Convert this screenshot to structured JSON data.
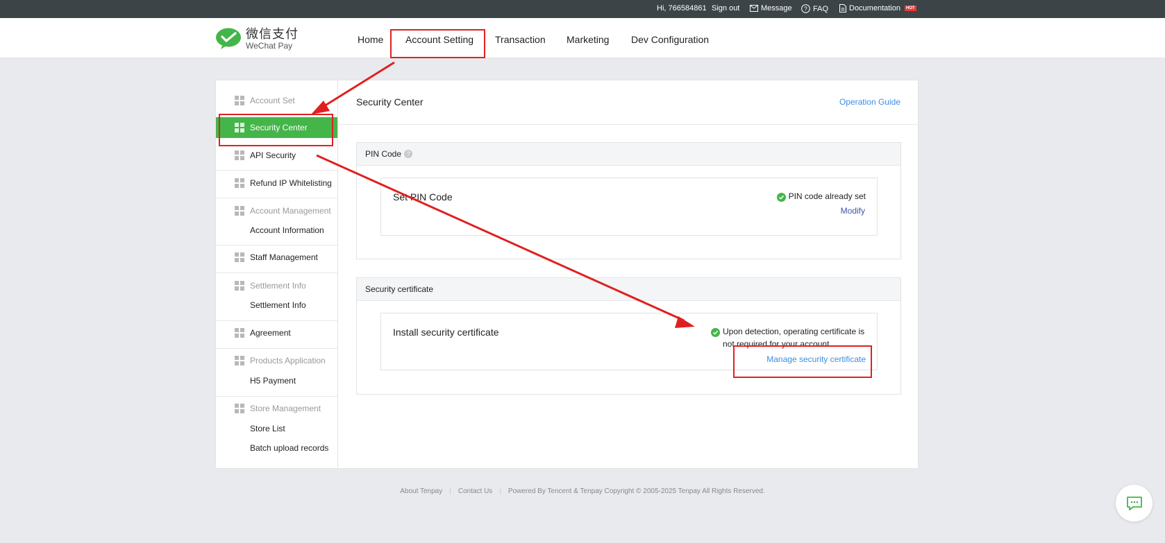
{
  "topbar": {
    "greeting": "Hi, 766584861",
    "sign_out": "Sign out",
    "message": "Message",
    "faq": "FAQ",
    "documentation": "Documentation",
    "hot_badge": "HOT"
  },
  "header": {
    "logo_cn": "微信支付",
    "logo_en": "WeChat Pay",
    "nav": [
      "Home",
      "Account Setting",
      "Transaction",
      "Marketing",
      "Dev Configuration"
    ]
  },
  "sidebar": {
    "account_set": "Account Set",
    "security_center": "Security Center",
    "api_security": "API Security",
    "refund_ip": "Refund IP Whitelisting",
    "account_management": "Account Management",
    "account_information": "Account Information",
    "staff_management": "Staff Management",
    "settlement_info_head": "Settlement Info",
    "settlement_info": "Settlement Info",
    "agreement": "Agreement",
    "products_application": "Products Application",
    "h5_payment": "H5 Payment",
    "store_management": "Store Management",
    "store_list": "Store List",
    "batch_upload": "Batch upload records"
  },
  "main": {
    "title": "Security Center",
    "operation_guide": "Operation Guide",
    "pin": {
      "header": "PIN Code",
      "help": "?",
      "label": "Set PIN Code",
      "status": "PIN code already set",
      "action": "Modify"
    },
    "cert": {
      "header": "Security certificate",
      "label": "Install security certificate",
      "status_line1": "Upon detection, operating certificate is",
      "status_line2": "not required for your account",
      "action": "Manage security certificate"
    }
  },
  "footer": {
    "about": "About Tenpay",
    "contact": "Contact Us",
    "copyright": "Powered By Tencent & Tenpay Copyright © 2005-2025 Tenpay All Rights Reserved."
  },
  "colors": {
    "accent_green": "#44b549",
    "link_blue": "#3d8de3",
    "annotation_red": "#e02020",
    "topbar_bg": "#3d4448"
  }
}
